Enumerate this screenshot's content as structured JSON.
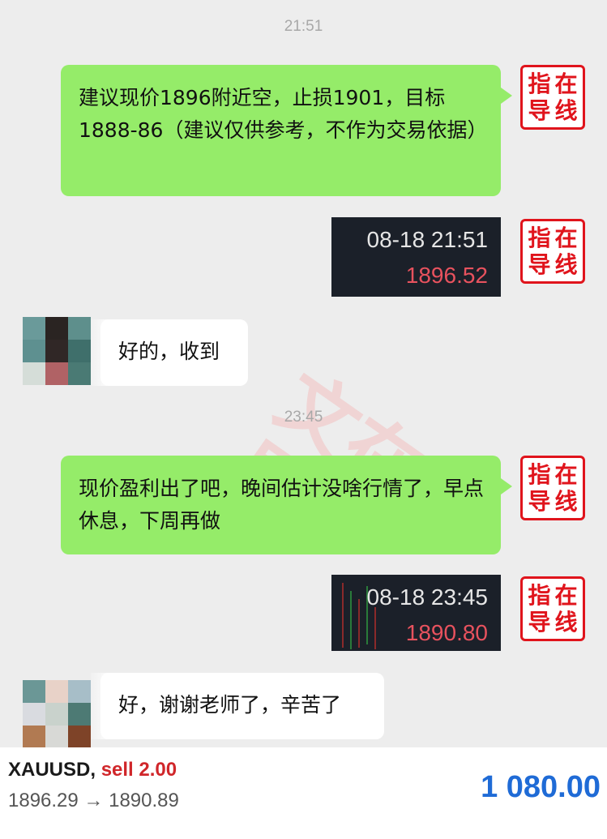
{
  "messages": [
    {
      "type": "timestamp",
      "text": "21:51"
    },
    {
      "type": "sent_text",
      "text": "建议现价1896附近空，止损1901，目标1888-86（建议仅供参考，不作为交易依据）"
    },
    {
      "type": "sent_image",
      "date": "08-18 21:51",
      "price": "1896.52"
    },
    {
      "type": "received_text",
      "text": "好的，收到"
    },
    {
      "type": "timestamp",
      "text": "23:45"
    },
    {
      "type": "sent_text",
      "text": "现价盈利出了吧，晚间估计没啥行情了，早点休息，下周再做"
    },
    {
      "type": "sent_image",
      "date": "08-18 23:45",
      "price": "1890.80"
    },
    {
      "type": "received_text",
      "text": "好，谢谢老师了，辛苦了"
    }
  ],
  "stamp": {
    "chars": [
      "指",
      "在",
      "导",
      "线"
    ]
  },
  "watermark": "文在指导",
  "footer": {
    "symbol": "XAUUSD,",
    "side": "sell 2.00",
    "prices": "1896.29 → 1890.89",
    "profit": "1 080.00"
  },
  "colors": {
    "sent_bubble": "#95ec69",
    "received_bubble": "#ffffff",
    "background": "#ededed",
    "stamp_red": "#e0141c",
    "sell_red": "#d0262a",
    "profit_blue": "#1f6bd6",
    "price_red": "#e8525e"
  }
}
